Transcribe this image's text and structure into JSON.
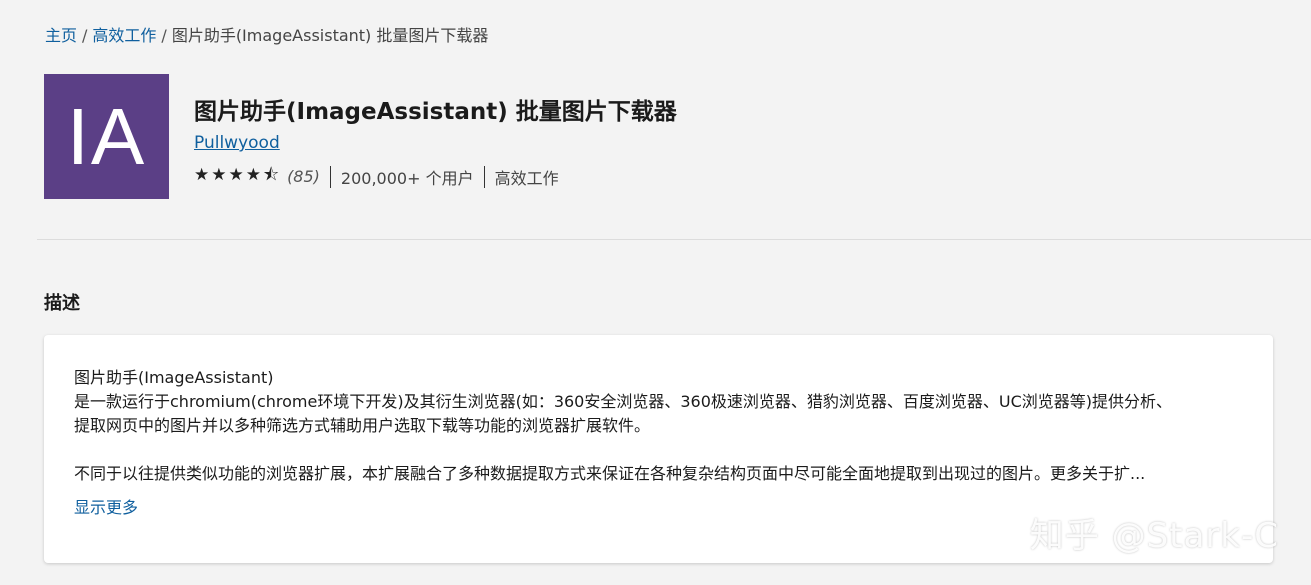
{
  "breadcrumb": {
    "home": "主页",
    "category": "高效工作",
    "separator": "/",
    "current": "图片助手(ImageAssistant) 批量图片下载器"
  },
  "extension": {
    "logo_text": "IA",
    "logo_color": "#5b3f86",
    "title": "图片助手(ImageAssistant) 批量图片下载器",
    "publisher": "Pullwyood",
    "rating_value": 4.5,
    "stars_glyph": "★★★★⯪",
    "rating_count": "(85)",
    "users": "200,000+ 个用户",
    "category": "高效工作"
  },
  "description": {
    "heading": "描述",
    "line1": "图片助手(ImageAssistant)",
    "line2": "是一款运行于chromium(chrome环境下开发)及其衍生浏览器(如：360安全浏览器、360极速浏览器、猎豹浏览器、百度浏览器、UC浏览器等)提供分析、",
    "line3": "提取网页中的图片并以多种筛选方式辅助用户选取下载等功能的浏览器扩展软件。",
    "line4": "不同于以往提供类似功能的浏览器扩展，本扩展融合了多种数据提取方式来保证在各种复杂结构页面中尽可能全面地提取到出现过的图片。更多关于扩...",
    "show_more": "显示更多"
  },
  "watermark": "知乎 @Stark-C",
  "colors": {
    "link": "#0f5f9e",
    "background": "#f3f3f3"
  }
}
